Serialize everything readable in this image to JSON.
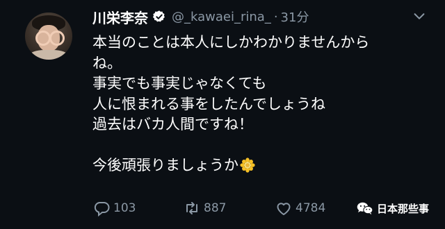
{
  "tweet": {
    "display_name": "川栄李奈",
    "handle": "@_kawaei_rina_",
    "separator": "·",
    "time": "31分",
    "verified_icon": "verified-badge-icon",
    "more_icon": "chevron-down-icon",
    "lines": [
      "本当のことは本人にしかわかりませんから",
      "ね。",
      "事実でも事実じゃなくても",
      "人に恨まれる事をしたんでしょうね",
      "過去はバカ人間ですね！",
      "",
      "今後頑張りましょうか"
    ],
    "emoji": "sunflower-icon",
    "actions": {
      "reply_count": "103",
      "retweet_count": "887",
      "like_count": "4784"
    }
  },
  "watermark": {
    "icon": "wechat-icon",
    "text": "日本那些事"
  },
  "colors": {
    "background": "#0b0f14",
    "text": "#ffffff",
    "muted": "#8b98a5"
  }
}
